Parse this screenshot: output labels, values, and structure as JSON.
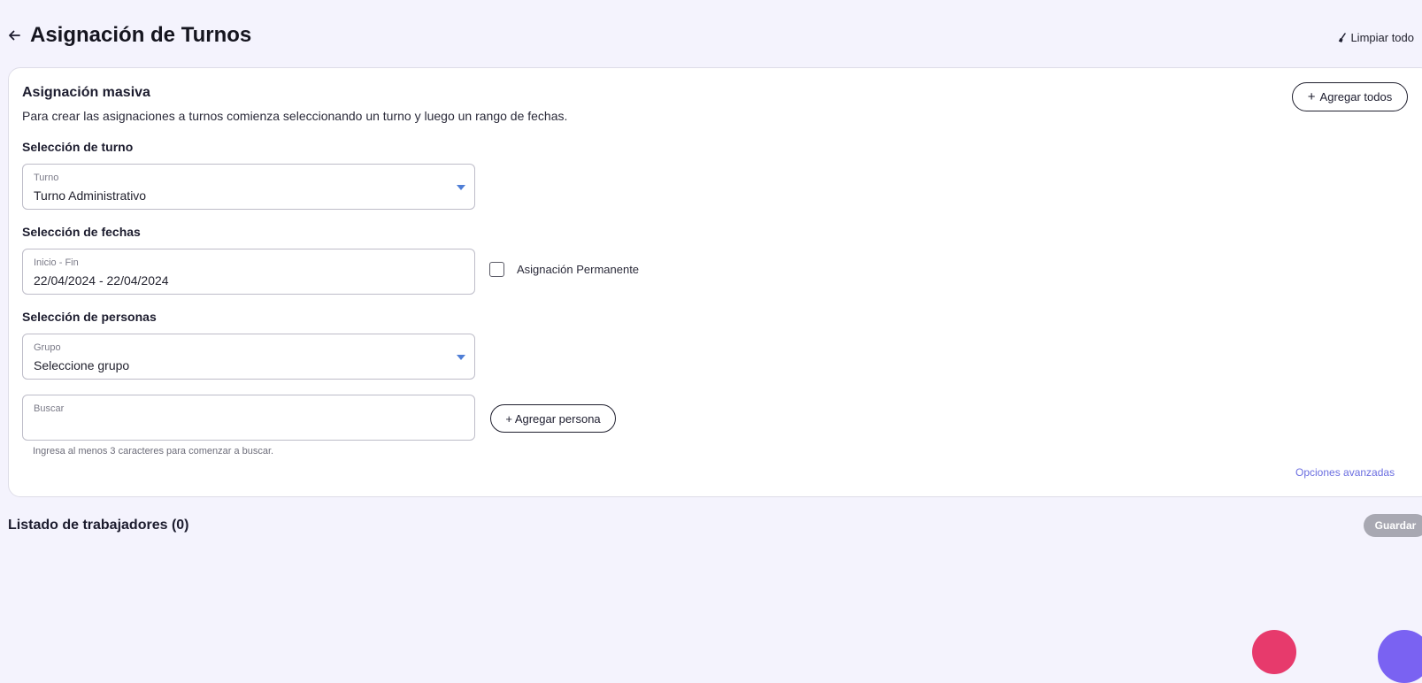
{
  "header": {
    "title": "Asignación de Turnos",
    "clear_all_label": "Limpiar todo"
  },
  "bulk": {
    "title": "Asignación masiva",
    "description": "Para crear las asignaciones a turnos comienza seleccionando un turno y luego un rango de fechas.",
    "add_all_label": "Agregar todos"
  },
  "shift_section": {
    "label": "Selección de turno",
    "field_label": "Turno",
    "value": "Turno Administrativo"
  },
  "dates_section": {
    "label": "Selección de fechas",
    "field_label": "Inicio - Fin",
    "value": "22/04/2024 - 22/04/2024",
    "permanent_label": "Asignación Permanente",
    "permanent_checked": false
  },
  "people_section": {
    "label": "Selección de personas",
    "group_field_label": "Grupo",
    "group_value": "Seleccione grupo",
    "search_field_label": "Buscar",
    "search_value": "",
    "add_person_label": "+ Agregar persona",
    "search_hint": "Ingresa al menos 3 caracteres para comenzar a buscar."
  },
  "advanced_options_label": "Opciones avanzadas",
  "workers_list": {
    "title": "Listado de trabajadores (0)",
    "save_label": "Guardar"
  },
  "colors": {
    "background": "#f4f3fd",
    "accent_link": "#6b6ee0",
    "caret": "#4f7ed6",
    "save_disabled": "#a8a8b2",
    "fab_red": "#e73a6c",
    "fab_purple": "#7a62f2"
  }
}
